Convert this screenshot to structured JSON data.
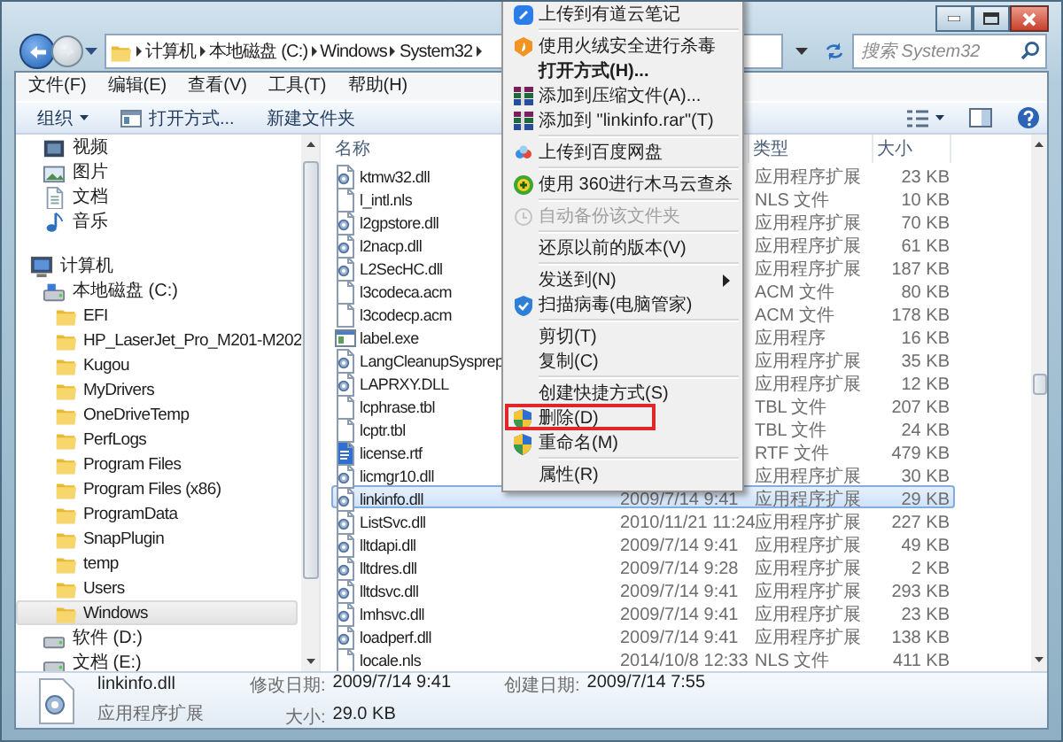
{
  "address_bar": {
    "breadcrumbs": [
      "计算机",
      "本地磁盘 (C:)",
      "Windows",
      "System32"
    ],
    "search": {
      "placeholder": "搜索 System32"
    }
  },
  "menu_bar": [
    "文件(F)",
    "编辑(E)",
    "查看(V)",
    "工具(T)",
    "帮助(H)"
  ],
  "toolbar": {
    "buttons": [
      {
        "label": "组织",
        "kind": "dropdown"
      },
      {
        "label": "打开方式...",
        "kind": "open"
      },
      {
        "label": "新建文件夹",
        "kind": "plain"
      }
    ]
  },
  "nav_pane": {
    "libraries": [
      {
        "label": "视频",
        "kind": "videos",
        "selected": false
      },
      {
        "label": "图片",
        "kind": "pictures",
        "selected": false
      },
      {
        "label": "文档",
        "kind": "documents",
        "selected": false
      },
      {
        "label": "音乐",
        "kind": "music",
        "selected": false
      }
    ],
    "tree": [
      {
        "label": "计算机",
        "kind": "computer",
        "selected": false,
        "children": [
          {
            "label": "本地磁盘 (C:)",
            "kind": "system-drive",
            "selected": false,
            "children": [
              {
                "label": "EFI",
                "kind": "folder",
                "selected": false
              },
              {
                "label": "HP_LaserJet_Pro_M201-M202",
                "kind": "folder",
                "selected": false
              },
              {
                "label": "Kugou",
                "kind": "folder",
                "selected": false
              },
              {
                "label": "MyDrivers",
                "kind": "folder",
                "selected": false
              },
              {
                "label": "OneDriveTemp",
                "kind": "folder",
                "selected": false
              },
              {
                "label": "PerfLogs",
                "kind": "folder",
                "selected": false
              },
              {
                "label": "Program Files",
                "kind": "folder",
                "selected": false
              },
              {
                "label": "Program Files (x86)",
                "kind": "folder",
                "selected": false
              },
              {
                "label": "ProgramData",
                "kind": "folder",
                "selected": false
              },
              {
                "label": "SnapPlugin",
                "kind": "folder",
                "selected": false
              },
              {
                "label": "temp",
                "kind": "folder",
                "selected": false
              },
              {
                "label": "Users",
                "kind": "folder",
                "selected": false
              },
              {
                "label": "Windows",
                "kind": "folder",
                "selected": true
              }
            ]
          },
          {
            "label": "软件 (D:)",
            "kind": "drive",
            "selected": false
          },
          {
            "label": "文档 (E:)",
            "kind": "drive",
            "selected": false
          }
        ]
      }
    ]
  },
  "file_list": {
    "columns": [
      {
        "label": "名称"
      },
      {
        "label": "类型"
      },
      {
        "label": "大小"
      }
    ],
    "rows": [
      {
        "name": "ktmw32.dll",
        "type": "应用程序扩展",
        "size": "23 KB",
        "kind": "extension",
        "selected": false
      },
      {
        "name": "l_intl.nls",
        "type": "NLS 文件",
        "size": "10 KB",
        "kind": "plain",
        "selected": false
      },
      {
        "name": "l2gpstore.dll",
        "type": "应用程序扩展",
        "size": "70 KB",
        "kind": "extension",
        "selected": false
      },
      {
        "name": "l2nacp.dll",
        "type": "应用程序扩展",
        "size": "61 KB",
        "kind": "extension",
        "selected": false
      },
      {
        "name": "L2SecHC.dll",
        "type": "应用程序扩展",
        "size": "187 KB",
        "kind": "extension",
        "selected": false
      },
      {
        "name": "l3codeca.acm",
        "type": "ACM 文件",
        "size": "80 KB",
        "kind": "plain",
        "selected": false
      },
      {
        "name": "l3codecp.acm",
        "type": "ACM 文件",
        "size": "178 KB",
        "kind": "plain",
        "selected": false
      },
      {
        "name": "label.exe",
        "type": "应用程序",
        "size": "16 KB",
        "kind": "program",
        "selected": false
      },
      {
        "name": "LangCleanupSysprep",
        "type": "应用程序扩展",
        "size": "35 KB",
        "kind": "extension",
        "selected": false
      },
      {
        "name": "LAPRXY.DLL",
        "type": "应用程序扩展",
        "size": "12 KB",
        "kind": "extension",
        "selected": false
      },
      {
        "name": "lcphrase.tbl",
        "type": "TBL 文件",
        "size": "207 KB",
        "kind": "plain",
        "selected": false
      },
      {
        "name": "lcptr.tbl",
        "type": "TBL 文件",
        "size": "24 KB",
        "kind": "plain",
        "selected": false
      },
      {
        "name": "license.rtf",
        "type": "RTF 文件",
        "size": "479 KB",
        "kind": "richtext",
        "selected": false
      },
      {
        "name": "licmgr10.dll",
        "type": "应用程序扩展",
        "size": "30 KB",
        "kind": "extension",
        "selected": false
      },
      {
        "name": "linkinfo.dll",
        "date": "2009/7/14 9:41",
        "type": "应用程序扩展",
        "size": "29 KB",
        "kind": "extension",
        "selected": true
      },
      {
        "name": "ListSvc.dll",
        "date": "2010/11/21 11:24",
        "type": "应用程序扩展",
        "size": "227 KB",
        "kind": "extension",
        "selected": false
      },
      {
        "name": "lltdapi.dll",
        "date": "2009/7/14 9:41",
        "type": "应用程序扩展",
        "size": "49 KB",
        "kind": "extension",
        "selected": false
      },
      {
        "name": "lltdres.dll",
        "date": "2009/7/14 9:28",
        "type": "应用程序扩展",
        "size": "2 KB",
        "kind": "extension",
        "selected": false
      },
      {
        "name": "lltdsvc.dll",
        "date": "2009/7/14 9:41",
        "type": "应用程序扩展",
        "size": "293 KB",
        "kind": "extension",
        "selected": false
      },
      {
        "name": "lmhsvc.dll",
        "date": "2009/7/14 9:41",
        "type": "应用程序扩展",
        "size": "23 KB",
        "kind": "extension",
        "selected": false
      },
      {
        "name": "loadperf.dll",
        "date": "2009/7/14 9:41",
        "type": "应用程序扩展",
        "size": "138 KB",
        "kind": "extension",
        "selected": false
      },
      {
        "name": "locale.nls",
        "date": "2014/10/8 12:33",
        "type": "NLS 文件",
        "size": "411 KB",
        "kind": "plain",
        "selected": false
      }
    ]
  },
  "details_pane": {
    "name": "linkinfo.dll",
    "type": "应用程序扩展",
    "fields": [
      {
        "label": "修改日期:",
        "value": "2009/7/14 9:41"
      },
      {
        "label": "大小:",
        "value": "29.0 KB"
      },
      {
        "label": "创建日期:",
        "value": "2009/7/14 7:55"
      }
    ]
  },
  "context_menu": {
    "groups": [
      [
        {
          "label": "上传到有道云笔记",
          "default": false,
          "disabled": false,
          "submenu": false,
          "outlined": false
        }
      ],
      [
        {
          "label": "使用火绒安全进行杀毒",
          "default": false,
          "disabled": false,
          "submenu": false,
          "outlined": false
        },
        {
          "label": "打开方式(H)...",
          "default": true,
          "disabled": false,
          "submenu": false,
          "outlined": false
        },
        {
          "label": "添加到压缩文件(A)...",
          "default": false,
          "disabled": false,
          "submenu": false,
          "outlined": false
        },
        {
          "label": "添加到 \"linkinfo.rar\"(T)",
          "default": false,
          "disabled": false,
          "submenu": false,
          "outlined": false
        }
      ],
      [
        {
          "label": "上传到百度网盘",
          "default": false,
          "disabled": false,
          "submenu": false,
          "outlined": false
        }
      ],
      [
        {
          "label": "使用 360进行木马云查杀",
          "default": false,
          "disabled": false,
          "submenu": false,
          "outlined": false
        }
      ],
      [
        {
          "label": "自动备份该文件夹",
          "default": false,
          "disabled": true,
          "submenu": false,
          "outlined": false
        }
      ],
      [
        {
          "label": "还原以前的版本(V)",
          "default": false,
          "disabled": false,
          "submenu": false,
          "outlined": false
        }
      ],
      [
        {
          "label": "发送到(N)",
          "default": false,
          "disabled": false,
          "submenu": true,
          "outlined": false
        },
        {
          "label": "扫描病毒(电脑管家)",
          "default": false,
          "disabled": false,
          "submenu": false,
          "outlined": false
        }
      ],
      [
        {
          "label": "剪切(T)",
          "default": false,
          "disabled": false,
          "submenu": false,
          "outlined": false
        },
        {
          "label": "复制(C)",
          "default": false,
          "disabled": false,
          "submenu": false,
          "outlined": false
        }
      ],
      [
        {
          "label": "创建快捷方式(S)",
          "default": false,
          "disabled": false,
          "submenu": false,
          "outlined": false
        },
        {
          "label": "删除(D)",
          "default": false,
          "disabled": false,
          "submenu": false,
          "outlined": true
        },
        {
          "label": "重命名(M)",
          "default": false,
          "disabled": false,
          "submenu": false,
          "outlined": false
        }
      ],
      [
        {
          "label": "属性(R)",
          "default": false,
          "disabled": false,
          "submenu": false,
          "outlined": false
        }
      ]
    ]
  }
}
